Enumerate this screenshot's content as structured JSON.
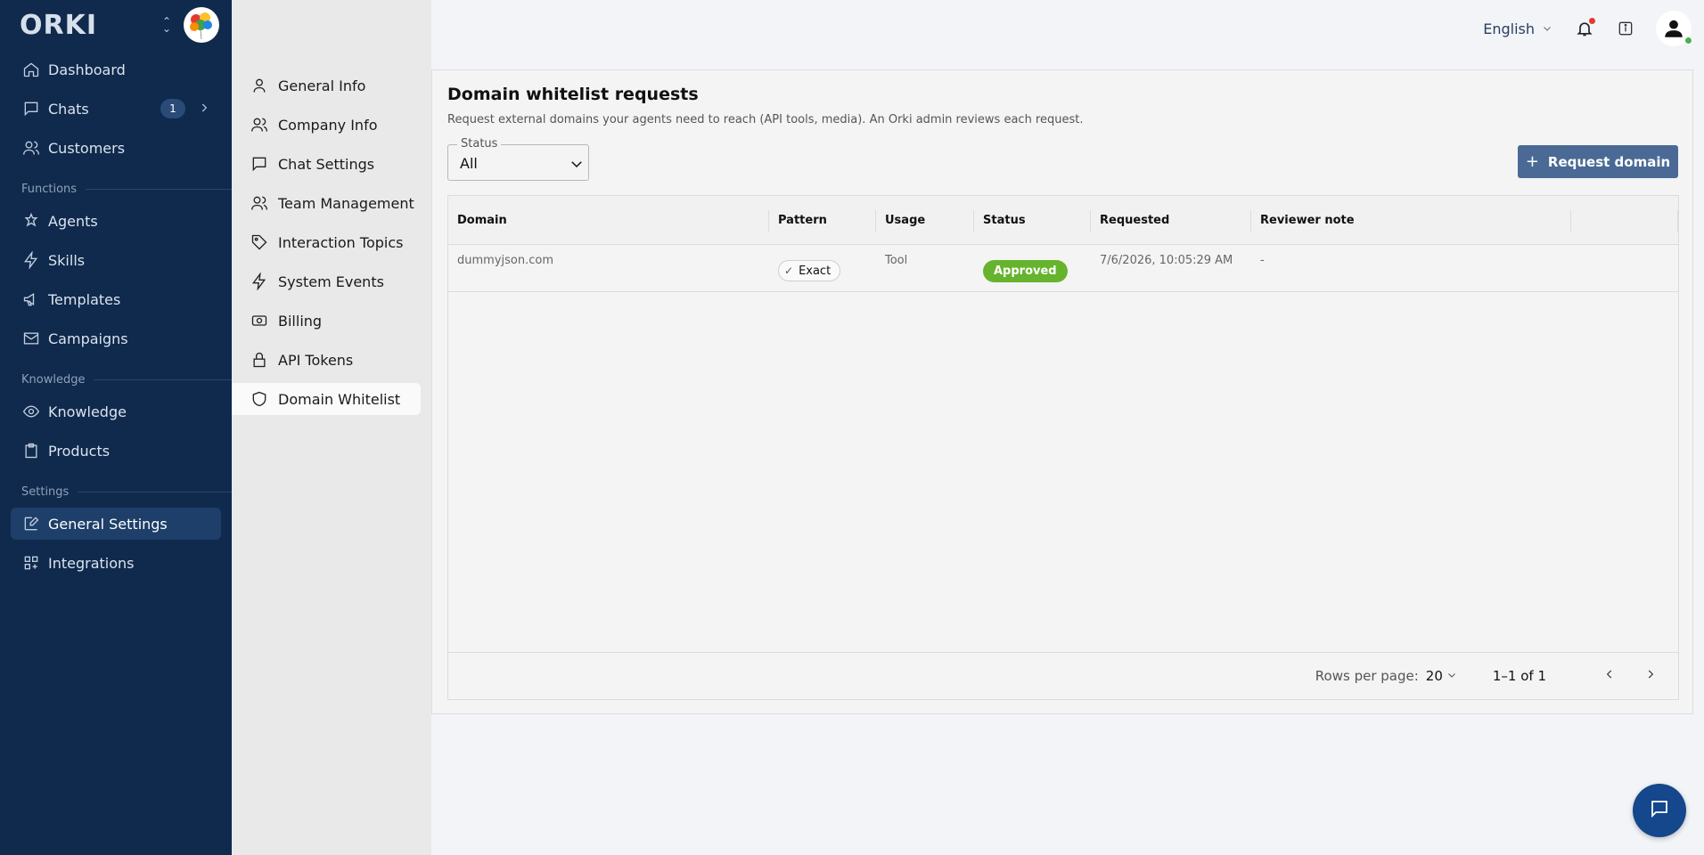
{
  "brand": {
    "logo_text": "ORKI"
  },
  "sidebar": {
    "items": [
      {
        "label": "Dashboard",
        "icon": "home-icon"
      },
      {
        "label": "Chats",
        "icon": "chat-icon",
        "badge": "1"
      },
      {
        "label": "Customers",
        "icon": "users-icon"
      }
    ],
    "sections": [
      {
        "title": "Functions",
        "items": [
          {
            "label": "Agents",
            "icon": "agents-icon"
          },
          {
            "label": "Skills",
            "icon": "bolt-icon"
          },
          {
            "label": "Templates",
            "icon": "megaphone-icon"
          },
          {
            "label": "Campaigns",
            "icon": "mail-icon"
          }
        ]
      },
      {
        "title": "Knowledge",
        "items": [
          {
            "label": "Knowledge",
            "icon": "eye-icon"
          },
          {
            "label": "Products",
            "icon": "clipboard-icon"
          }
        ]
      },
      {
        "title": "Settings",
        "items": [
          {
            "label": "General Settings",
            "icon": "edit-icon",
            "active": true
          },
          {
            "label": "Integrations",
            "icon": "grid-icon"
          }
        ]
      }
    ]
  },
  "submenu": {
    "items": [
      {
        "label": "General Info",
        "icon": "user-icon"
      },
      {
        "label": "Company Info",
        "icon": "users-icon"
      },
      {
        "label": "Chat Settings",
        "icon": "chat-icon"
      },
      {
        "label": "Team Management",
        "icon": "team-icon"
      },
      {
        "label": "Interaction Topics",
        "icon": "tag-icon"
      },
      {
        "label": "System Events",
        "icon": "bolt-icon"
      },
      {
        "label": "Billing",
        "icon": "billing-icon"
      },
      {
        "label": "API Tokens",
        "icon": "lock-icon"
      },
      {
        "label": "Domain Whitelist",
        "icon": "shield-icon",
        "active": true
      }
    ]
  },
  "topbar": {
    "language": "English"
  },
  "page": {
    "title": "Domain whitelist requests",
    "description": "Request external domains your agents need to reach (API tools, media). An Orki admin reviews each request.",
    "status_filter": {
      "label": "Status",
      "value": "All"
    },
    "request_button": "Request domain"
  },
  "table": {
    "columns": [
      "Domain",
      "Pattern",
      "Usage",
      "Status",
      "Requested",
      "Reviewer note",
      ""
    ],
    "rows": [
      {
        "domain": "dummyjson.com",
        "pattern": "Exact",
        "usage": "Tool",
        "status": "Approved",
        "requested": "7/6/2026, 10:05:29 AM",
        "note": "-"
      }
    ],
    "footer": {
      "rows_per_page_label": "Rows per page:",
      "rows_per_page": "20",
      "range": "1–1 of 1"
    }
  },
  "colors": {
    "sidebar_bg": "#0f2a4d",
    "approved": "#66b32e",
    "primary_button": "#4a6a95",
    "fab": "#14478c"
  }
}
